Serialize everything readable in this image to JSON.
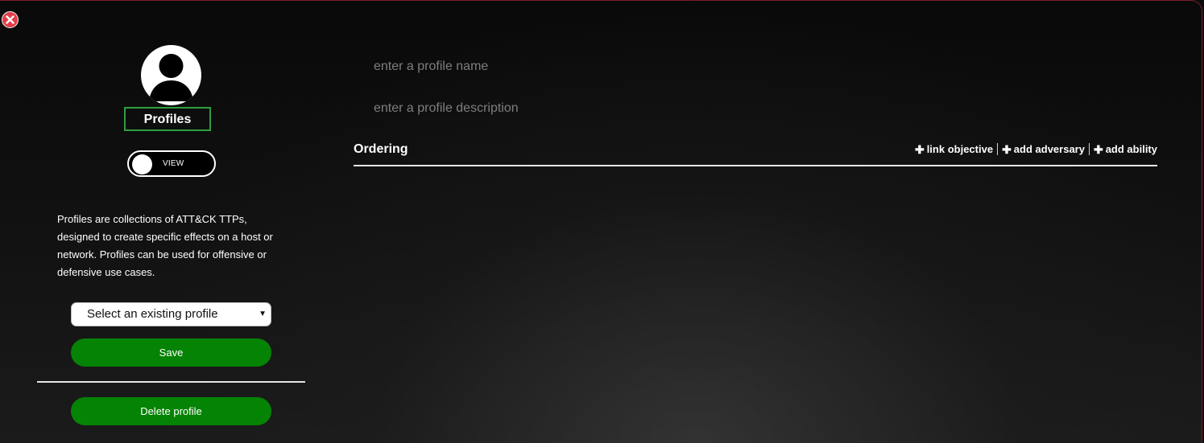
{
  "window": {
    "close_icon": "close-icon",
    "accent_border": "#7a1f2a"
  },
  "sidebar": {
    "avatar_icon": "user-silhouette-icon",
    "title": "Profiles",
    "toggle_label": "VIEW",
    "description": "Profiles are collections of ATT&CK TTPs, designed to create specific effects on a host or network. Profiles can be used for offensive or defensive use cases.",
    "select": {
      "selected": "Select an existing profile",
      "caret_icon": "caret-down-icon"
    },
    "save_label": "Save",
    "delete_label": "Delete profile",
    "button_color": "#058305",
    "title_border_color": "#2e9e3e"
  },
  "main": {
    "name_placeholder": "enter a profile name",
    "description_placeholder": "enter a profile description",
    "ordering_title": "Ordering",
    "actions": [
      {
        "icon": "plus-icon",
        "label": "link objective"
      },
      {
        "icon": "plus-icon",
        "label": "add adversary"
      },
      {
        "icon": "plus-icon",
        "label": "add ability"
      }
    ]
  }
}
